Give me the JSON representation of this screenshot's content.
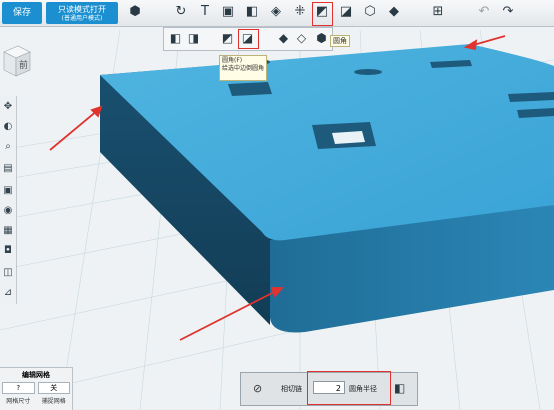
{
  "toolbar": {
    "save_label": "保存",
    "project_label": "只读模式打开",
    "project_sub": "(普通用户模式)",
    "icons": [
      "cube-view-icon",
      "rotate-icon",
      "text-icon",
      "box-icon",
      "solid-icon",
      "transform-icon",
      "pattern-icon",
      "fillet-icon",
      "chamfer-icon",
      "shell-icon",
      "combine-icon",
      "insert-icon",
      "undo-icon",
      "redo-icon"
    ]
  },
  "subbar": {
    "icons": [
      "solid-a-icon",
      "solid-b-icon",
      "solid-c-icon",
      "fillet-active-icon",
      "solid-d-icon",
      "solid-e-icon",
      "solid-f-icon"
    ]
  },
  "tooltip": {
    "line1": "圆角(F)",
    "line2": "给选中边倒圆角"
  },
  "hint": "圆角",
  "viewcube": {
    "label": "前"
  },
  "left_tools": [
    "move-icon",
    "paint-icon",
    "search-icon",
    "layer-icon",
    "box-icon",
    "eye-icon",
    "frame-icon",
    "camera-icon",
    "stack-icon",
    "measure-icon"
  ],
  "grid_panel": {
    "title": "编辑网格",
    "value1": "?",
    "value2": "关",
    "label1": "网格尺寸",
    "label2": "捕捉网格"
  },
  "fillet_panel": {
    "label": "圆角半径",
    "value": "2",
    "option": "相切链"
  }
}
